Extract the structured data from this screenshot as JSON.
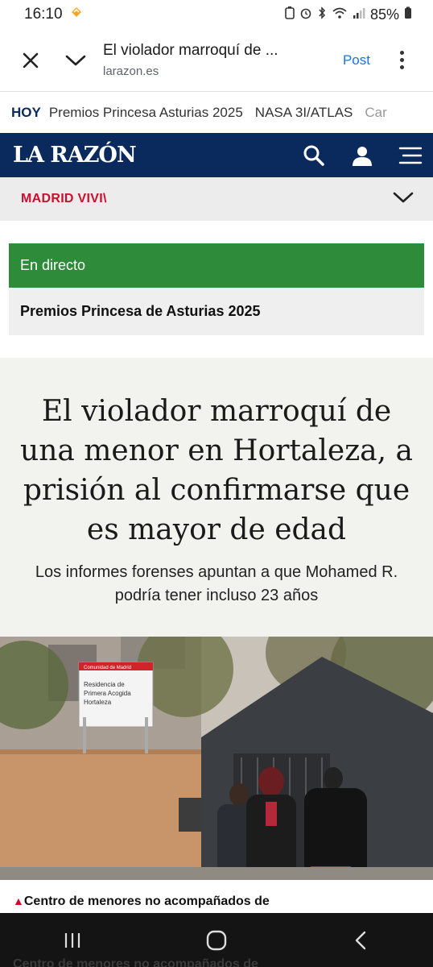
{
  "status_bar": {
    "time": "16:10",
    "battery": "85%"
  },
  "tab_header": {
    "title": "El violador marroquí de ...",
    "url": "larazon.es",
    "post_label": "Post"
  },
  "trending": {
    "hoy_label": "HOY",
    "items": [
      "Premios Princesa Asturias 2025",
      "NASA 3I/ATLAS",
      "Car"
    ]
  },
  "brand": {
    "logo": "LA RAZÓN"
  },
  "section": {
    "name": "MADRID VIVI\\"
  },
  "live": {
    "label": "En directo",
    "title": "Premios Princesa de Asturias 2025"
  },
  "article": {
    "headline": "El violador marroquí de una menor en Hortaleza, a prisión al confirmarse que es mayor de edad",
    "subtitle": "Los informes forenses apuntan a que Mohamed R. podría tener incluso 23 años",
    "sign_lines": [
      "Comunidad de Madrid",
      "Residencia de",
      "Primera Acogida",
      "Hortaleza"
    ],
    "caption": "Centro de menores no acompañados de"
  },
  "colors": {
    "brand_navy": "#0a2a5e",
    "live_green": "#2e8b3a",
    "section_red": "#c8102e",
    "link_blue": "#1a73e8"
  }
}
